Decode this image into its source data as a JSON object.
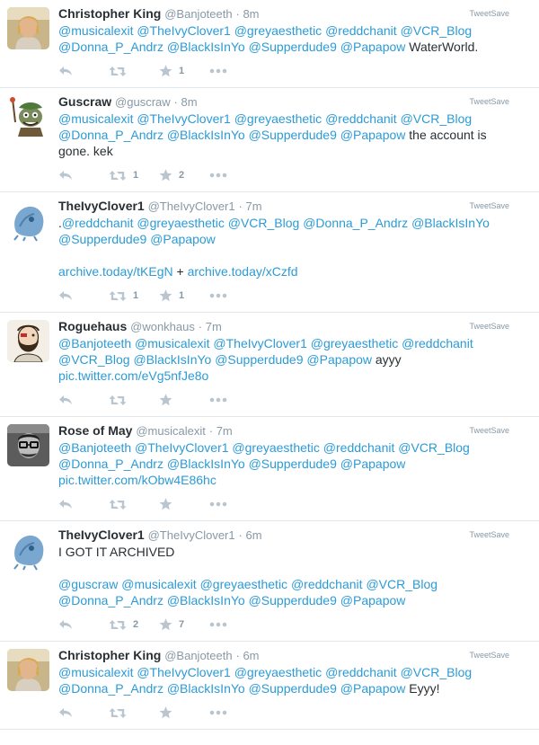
{
  "tweets": [
    {
      "name": "Christopher King",
      "handle": "@Banjoteeth",
      "time": "8m",
      "badge": "TweetSave",
      "avatar": "user-photo-blond",
      "lines": [
        [
          {
            "m": "@musicalexit"
          },
          {
            "t": " "
          },
          {
            "m": "@TheIvyClover1"
          },
          {
            "t": " "
          },
          {
            "m": "@greyaesthetic"
          },
          {
            "t": " "
          },
          {
            "m": "@reddchanit"
          },
          {
            "t": " "
          },
          {
            "m": "@VCR_Blog"
          }
        ],
        [
          {
            "m": "@Donna_P_Andrz"
          },
          {
            "t": " "
          },
          {
            "m": "@BlackIsInYo"
          },
          {
            "t": " "
          },
          {
            "m": "@Supperdude9"
          },
          {
            "t": " "
          },
          {
            "m": "@Papapow"
          },
          {
            "t": " WaterWorld."
          }
        ]
      ],
      "retweets": "",
      "favorites": "1"
    },
    {
      "name": "Guscraw",
      "handle": "@guscraw",
      "time": "8m",
      "badge": "TweetSave",
      "avatar": "cartoon-goblin",
      "lines": [
        [
          {
            "m": "@musicalexit"
          },
          {
            "t": " "
          },
          {
            "m": "@TheIvyClover1"
          },
          {
            "t": " "
          },
          {
            "m": "@greyaesthetic"
          },
          {
            "t": " "
          },
          {
            "m": "@reddchanit"
          },
          {
            "t": " "
          },
          {
            "m": "@VCR_Blog"
          }
        ],
        [
          {
            "m": "@Donna_P_Andrz"
          },
          {
            "t": " "
          },
          {
            "m": "@BlackIsInYo"
          },
          {
            "t": " "
          },
          {
            "m": "@Supperdude9"
          },
          {
            "t": " "
          },
          {
            "m": "@Papapow"
          },
          {
            "t": " the account is"
          }
        ],
        [
          {
            "t": "gone. kek"
          }
        ]
      ],
      "retweets": "1",
      "favorites": "2"
    },
    {
      "name": "TheIvyClover1",
      "handle": "@TheIvyClover1",
      "time": "7m",
      "badge": "TweetSave",
      "avatar": "blue-creature",
      "lines": [
        [
          {
            "t": "."
          },
          {
            "m": "@reddchanit"
          },
          {
            "t": " "
          },
          {
            "m": "@greyaesthetic"
          },
          {
            "t": " "
          },
          {
            "m": "@VCR_Blog"
          },
          {
            "t": " "
          },
          {
            "m": "@Donna_P_Andrz"
          },
          {
            "t": " "
          },
          {
            "m": "@BlackIsInYo"
          }
        ],
        [
          {
            "m": "@Supperdude9"
          },
          {
            "t": " "
          },
          {
            "m": "@Papapow"
          }
        ],
        [],
        [
          {
            "m": "archive.today/tKEgN"
          },
          {
            "t": " + "
          },
          {
            "m": "archive.today/xCzfd"
          }
        ]
      ],
      "retweets": "1",
      "favorites": "1"
    },
    {
      "name": "Roguehaus",
      "handle": "@wonkhaus",
      "time": "7m",
      "badge": "TweetSave",
      "avatar": "drawn-bearded-man",
      "lines": [
        [
          {
            "m": "@Banjoteeth"
          },
          {
            "t": " "
          },
          {
            "m": "@musicalexit"
          },
          {
            "t": " "
          },
          {
            "m": "@TheIvyClover1"
          },
          {
            "t": " "
          },
          {
            "m": "@greyaesthetic"
          },
          {
            "t": " "
          },
          {
            "m": "@reddchanit"
          }
        ],
        [
          {
            "m": "@VCR_Blog"
          },
          {
            "t": "  "
          },
          {
            "m": "@BlackIsInYo"
          },
          {
            "t": " "
          },
          {
            "m": "@Supperdude9"
          },
          {
            "t": " "
          },
          {
            "m": "@Papapow"
          },
          {
            "t": " ayyy"
          }
        ],
        [
          {
            "m": "pic.twitter.com/eVg5nfJe8o"
          }
        ]
      ],
      "retweets": "",
      "favorites": ""
    },
    {
      "name": "Rose of May",
      "handle": "@musicalexit",
      "time": "7m",
      "badge": "TweetSave",
      "avatar": "bw-glasses-man",
      "lines": [
        [
          {
            "m": "@Banjoteeth"
          },
          {
            "t": " "
          },
          {
            "m": "@TheIvyClover1"
          },
          {
            "t": " "
          },
          {
            "m": "@greyaesthetic"
          },
          {
            "t": " "
          },
          {
            "m": "@reddchanit"
          },
          {
            "t": " "
          },
          {
            "m": "@VCR_Blog"
          }
        ],
        [
          {
            "m": "@Donna_P_Andrz"
          },
          {
            "t": " "
          },
          {
            "m": "@BlackIsInYo"
          },
          {
            "t": " "
          },
          {
            "m": "@Supperdude9"
          },
          {
            "t": " "
          },
          {
            "m": "@Papapow"
          }
        ],
        [
          {
            "m": "pic.twitter.com/kObw4E86hc"
          }
        ]
      ],
      "retweets": "",
      "favorites": ""
    },
    {
      "name": "TheIvyClover1",
      "handle": "@TheIvyClover1",
      "time": "6m",
      "badge": "TweetSave",
      "avatar": "blue-creature",
      "lines": [
        [
          {
            "t": "I GOT IT ARCHIVED"
          }
        ],
        [],
        [
          {
            "m": "@guscraw"
          },
          {
            "t": " "
          },
          {
            "m": "@musicalexit"
          },
          {
            "t": " "
          },
          {
            "m": "@greyaesthetic"
          },
          {
            "t": " "
          },
          {
            "m": "@reddchanit"
          },
          {
            "t": " "
          },
          {
            "m": "@VCR_Blog"
          }
        ],
        [
          {
            "m": "@Donna_P_Andrz"
          },
          {
            "t": " "
          },
          {
            "m": "@BlackIsInYo"
          },
          {
            "t": " "
          },
          {
            "m": "@Supperdude9"
          },
          {
            "t": " "
          },
          {
            "m": "@Papapow"
          }
        ]
      ],
      "retweets": "2",
      "favorites": "7"
    },
    {
      "name": "Christopher King",
      "handle": "@Banjoteeth",
      "time": "6m",
      "badge": "TweetSave",
      "avatar": "user-photo-blond",
      "lines": [
        [
          {
            "m": "@musicalexit"
          },
          {
            "t": " "
          },
          {
            "m": "@TheIvyClover1"
          },
          {
            "t": " "
          },
          {
            "m": "@greyaesthetic"
          },
          {
            "t": " "
          },
          {
            "m": "@reddchanit"
          },
          {
            "t": " "
          },
          {
            "m": "@VCR_Blog"
          }
        ],
        [
          {
            "m": "@Donna_P_Andrz"
          },
          {
            "t": " "
          },
          {
            "m": "@BlackIsInYo"
          },
          {
            "t": " "
          },
          {
            "m": "@Supperdude9"
          },
          {
            "t": " "
          },
          {
            "m": "@Papapow"
          },
          {
            "t": " Eyyy!"
          }
        ]
      ],
      "retweets": "",
      "favorites": ""
    }
  ],
  "colors": {
    "mention": "#2b9bd6",
    "text": "#292f33",
    "muted": "#8899a6",
    "icon": "#b9c5cf",
    "border": "#e1e8ed"
  },
  "icons": [
    "reply-icon",
    "retweet-icon",
    "favorite-icon",
    "more-icon"
  ]
}
